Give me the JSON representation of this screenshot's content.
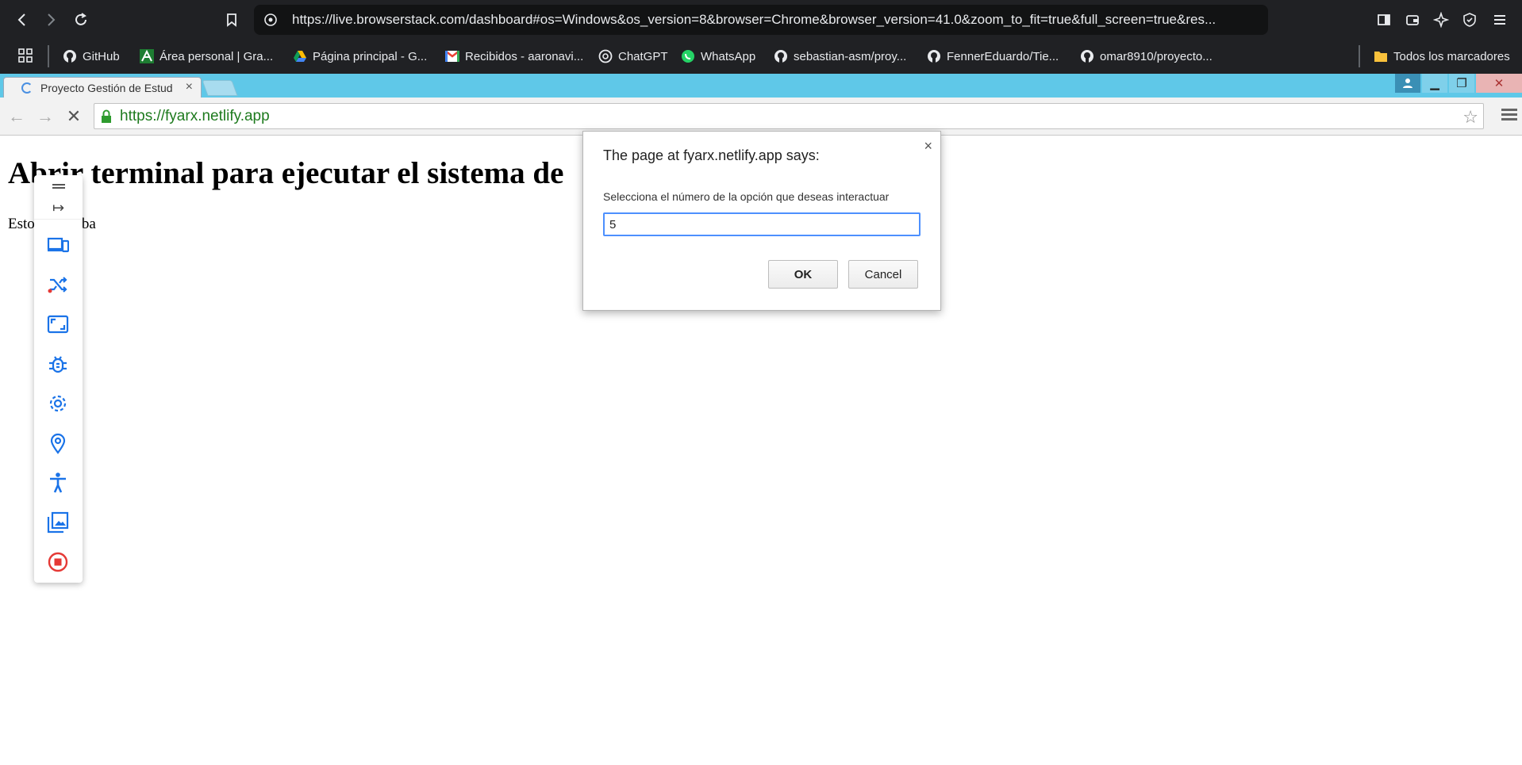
{
  "host_browser": {
    "address": "https://live.browserstack.com/dashboard#os=Windows&os_version=8&browser=Chrome&browser_version=41.0&zoom_to_fit=true&full_screen=true&res...",
    "bookmarks": [
      {
        "label": "GitHub",
        "icon": "github-icon"
      },
      {
        "label": "Área personal | Gra...",
        "icon": "moodle-icon"
      },
      {
        "label": "Página principal - G...",
        "icon": "google-drive-icon"
      },
      {
        "label": "Recibidos - aaronavi...",
        "icon": "gmail-icon"
      },
      {
        "label": "ChatGPT",
        "icon": "chatgpt-icon"
      },
      {
        "label": "WhatsApp",
        "icon": "whatsapp-icon"
      },
      {
        "label": "sebastian-asm/proy...",
        "icon": "github-icon"
      },
      {
        "label": "FennerEduardo/Tie...",
        "icon": "github-icon"
      },
      {
        "label": "omar8910/proyecto...",
        "icon": "github-icon"
      }
    ],
    "all_bookmarks": "Todos los marcadores"
  },
  "remote_browser": {
    "tab_title": "Proyecto Gestión de Estud",
    "address": "https://fyarx.netlify.app"
  },
  "page": {
    "heading": "Abrir terminal para ejecutar el sistema de",
    "paragraph": "Esto es prueba"
  },
  "dialog": {
    "title": "The page at fyarx.netlify.app says:",
    "message": "Selecciona el número de la opción que deseas interactuar",
    "input_value": "5",
    "ok_label": "OK",
    "cancel_label": "Cancel"
  },
  "bs_toolbar": {
    "tools": [
      {
        "name": "switch-device-icon",
        "color": "#1a73e8"
      },
      {
        "name": "shuffle-icon",
        "color": "#1a73e8"
      },
      {
        "name": "resize-icon",
        "color": "#1a73e8"
      },
      {
        "name": "bug-icon",
        "color": "#1a73e8"
      },
      {
        "name": "settings-icon",
        "color": "#1a73e8"
      },
      {
        "name": "location-icon",
        "color": "#1a73e8"
      },
      {
        "name": "accessibility-icon",
        "color": "#1a73e8"
      },
      {
        "name": "gallery-icon",
        "color": "#1a73e8"
      },
      {
        "name": "stop-session-icon",
        "color": "#e53935"
      }
    ]
  }
}
